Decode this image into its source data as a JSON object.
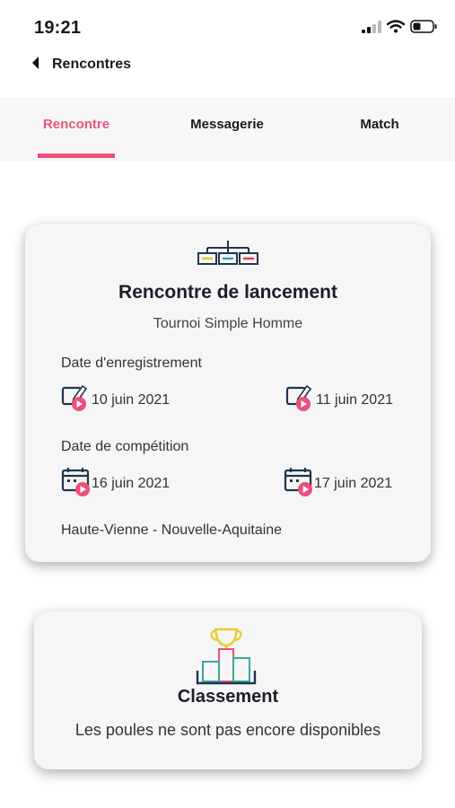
{
  "status": {
    "time": "19:21",
    "icons": [
      "signal-icon",
      "wifi-icon",
      "battery-icon"
    ]
  },
  "nav": {
    "back_label": "Rencontres"
  },
  "tabs": [
    {
      "label": "Rencontre",
      "active": true
    },
    {
      "label": "Messagerie",
      "active": false
    },
    {
      "label": "Match",
      "active": false
    }
  ],
  "colors": {
    "accent": "#ee4f7a",
    "navy": "#1f3550",
    "teal": "#3aa6a0",
    "yellow": "#e6cf2c"
  },
  "encounter": {
    "icon": "tournament-bracket-icon",
    "title": "Rencontre de lancement",
    "subtitle": "Tournoi Simple Homme",
    "registration": {
      "label": "Date d'enregistrement",
      "start": "10 juin 2021",
      "end": "11 juin 2021"
    },
    "competition": {
      "label": "Date de compétition",
      "start": "16 juin 2021",
      "end": "17 juin 2021"
    },
    "location": "Haute-Vienne - Nouvelle-Aquitaine"
  },
  "ranking": {
    "icon": "podium-trophy-icon",
    "title": "Classement",
    "message": "Les poules ne sont pas encore disponibles"
  }
}
